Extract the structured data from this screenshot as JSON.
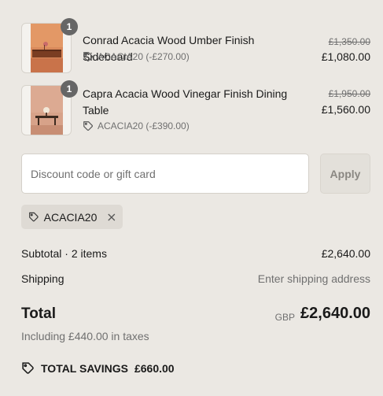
{
  "items": [
    {
      "quantity": "1",
      "title": "Conrad Acacia Wood Umber Finish Sideboard",
      "discount": "ACACIA20 (-£270.00)",
      "original_price": "£1,350.00",
      "price": "£1,080.00"
    },
    {
      "quantity": "1",
      "title": "Capra Acacia Wood Vinegar Finish Dining Table",
      "discount": "ACACIA20 (-£390.00)",
      "original_price": "£1,950.00",
      "price": "£1,560.00"
    }
  ],
  "discount": {
    "placeholder": "Discount code or gift card",
    "apply_label": "Apply",
    "applied_code": "ACACIA20"
  },
  "summary": {
    "subtotal_label": "Subtotal · 2 items",
    "subtotal_value": "£2,640.00",
    "shipping_label": "Shipping",
    "shipping_value": "Enter shipping address",
    "total_label": "Total",
    "currency": "GBP",
    "total_value": "£2,640.00",
    "taxes_note": "Including £440.00 in taxes",
    "savings_label": "TOTAL SAVINGS",
    "savings_value": "£660.00"
  },
  "icons": {
    "tag": "tag-icon",
    "close": "close-icon"
  }
}
